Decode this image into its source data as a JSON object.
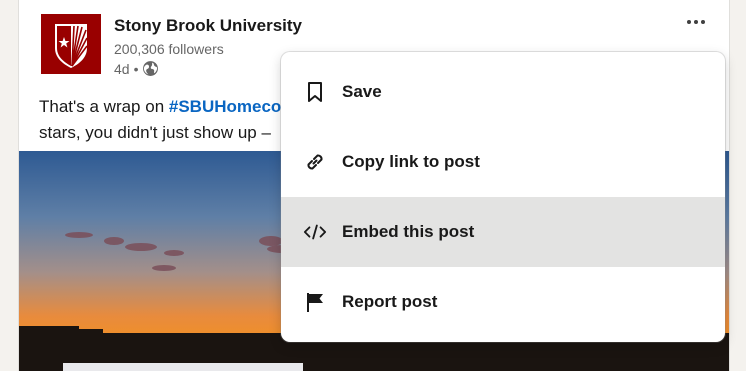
{
  "post": {
    "author": "Stony Brook University",
    "followers": "200,306 followers",
    "time": "4d",
    "separator": "•",
    "text_prefix": "That's a wrap on ",
    "hashtag": "#SBUHomecon",
    "text_line2": "stars, you didn't just show up –"
  },
  "menu": {
    "items": [
      {
        "label": "Save",
        "icon": "bookmark-icon"
      },
      {
        "label": "Copy link to post",
        "icon": "link-icon"
      },
      {
        "label": "Embed this post",
        "icon": "code-icon",
        "highlighted": true
      },
      {
        "label": "Report post",
        "icon": "flag-icon"
      }
    ]
  },
  "colors": {
    "brand": "#990000",
    "hashtag": "#0a66c2",
    "menu_hover": "#e3e3e2",
    "page_bg": "#f4f2ee"
  }
}
